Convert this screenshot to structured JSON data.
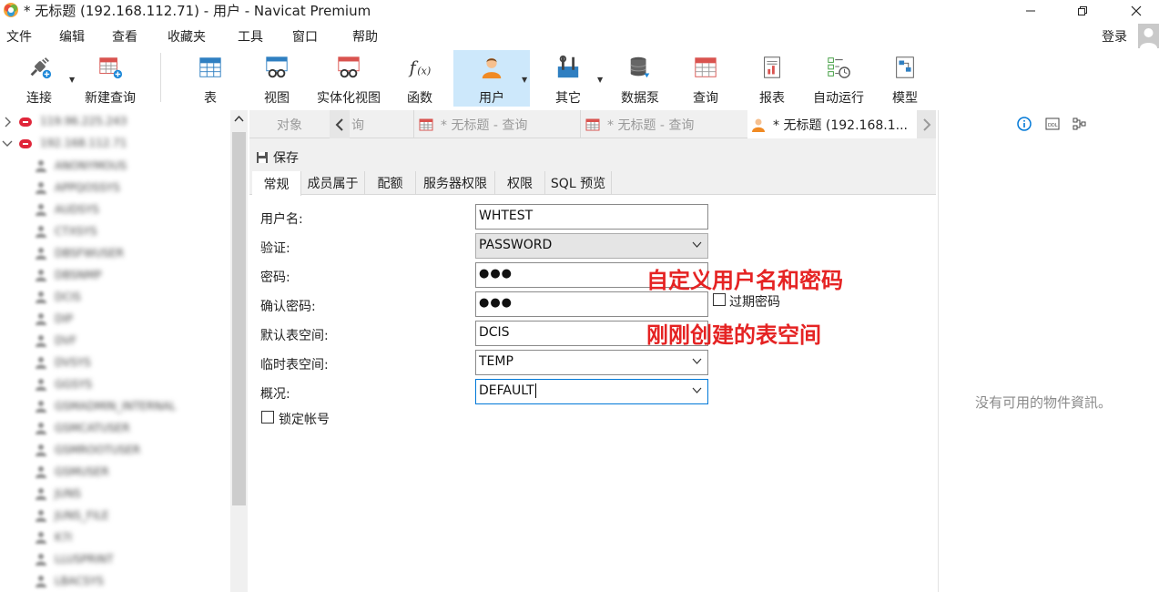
{
  "window": {
    "title": "* 无标题 (192.168.112.71) - 用户 - Navicat Premium"
  },
  "menu": [
    "文件",
    "编辑",
    "查看",
    "收藏夹",
    "工具",
    "窗口",
    "帮助"
  ],
  "login_label": "登录",
  "toolbar": [
    {
      "label": "连接",
      "icon": "plug-icon"
    },
    {
      "label": "新建查询",
      "icon": "new-query-icon"
    },
    {
      "label": "表",
      "icon": "table-icon"
    },
    {
      "label": "视图",
      "icon": "view-icon"
    },
    {
      "label": "实体化视图",
      "icon": "materialized-view-icon"
    },
    {
      "label": "函数",
      "icon": "function-icon"
    },
    {
      "label": "用户",
      "icon": "user-icon"
    },
    {
      "label": "其它",
      "icon": "tools-icon"
    },
    {
      "label": "数据泵",
      "icon": "data-pump-icon"
    },
    {
      "label": "查询",
      "icon": "query-icon"
    },
    {
      "label": "报表",
      "icon": "report-icon"
    },
    {
      "label": "自动运行",
      "icon": "automation-icon"
    },
    {
      "label": "模型",
      "icon": "model-icon"
    }
  ],
  "tree": {
    "connections": [
      "119.96.225.243",
      "192.168.112.71"
    ],
    "users": [
      "ANONYMOUS",
      "APPQOSSYS",
      "AUDSYS",
      "CTXSYS",
      "DBSFWUSER",
      "DBSNMP",
      "DCIS",
      "DIP",
      "DVF",
      "DVSYS",
      "GGSYS",
      "GSMADMIN_INTERNAL",
      "GSMCATUSER",
      "GSMROOTUSER",
      "GSMUSER",
      "JUNS",
      "JUNS_FILE",
      "K7I",
      "LLUSPRINT",
      "LBACSYS"
    ]
  },
  "tabs": [
    "对象",
    "询",
    "* 无标题 - 查询",
    "* 无标题 - 查询",
    "* 无标题 (192.168.1..."
  ],
  "save_label": "保存",
  "subtabs": [
    "常规",
    "成员属于",
    "配额",
    "服务器权限",
    "权限",
    "SQL 预览"
  ],
  "form": {
    "username_label": "用户名:",
    "username": "WHTEST",
    "auth_label": "验证:",
    "auth": "PASSWORD",
    "password_label": "密码:",
    "password": "●●●",
    "confirm_label": "确认密码:",
    "confirm": "●●●",
    "expire_label": "过期密码",
    "default_ts_label": "默认表空间:",
    "default_ts": "DCIS",
    "temp_ts_label": "临时表空间:",
    "temp_ts": "TEMP",
    "profile_label": "概况:",
    "profile": "DEFAULT",
    "lock_label": "锁定帐号"
  },
  "annotations": [
    "自定义用户名和密码",
    "刚刚创建的表空间"
  ],
  "right_pane": {
    "empty": "没有可用的物件資訊。"
  },
  "colors": {
    "accent": "#0078d7",
    "active_toolbar": "#cde8fb",
    "annotation": "#e52323",
    "connection_icon": "#e0263a"
  }
}
